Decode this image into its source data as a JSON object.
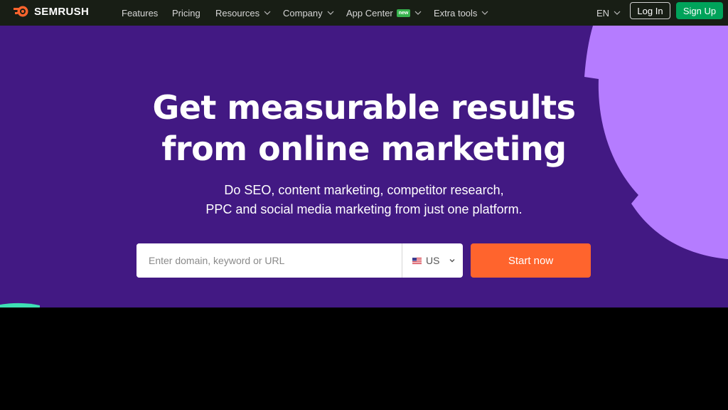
{
  "brand": {
    "name": "SEMRUSH",
    "logo_icon": "semrush-fire-icon",
    "accent": "#ff642d"
  },
  "nav": {
    "items": [
      {
        "label": "Features",
        "dropdown": false
      },
      {
        "label": "Pricing",
        "dropdown": false
      },
      {
        "label": "Resources",
        "dropdown": true
      },
      {
        "label": "Company",
        "dropdown": true
      },
      {
        "label": "App Center",
        "dropdown": true,
        "badge": "new"
      },
      {
        "label": "Extra tools",
        "dropdown": true
      }
    ],
    "language": "EN",
    "login_label": "Log In",
    "signup_label": "Sign Up"
  },
  "hero": {
    "title_line1": "Get measurable results",
    "title_line2": "from online marketing",
    "subtitle_line1": "Do SEO, content marketing, competitor research,",
    "subtitle_line2": "PPC and social media marketing from just one platform.",
    "search": {
      "placeholder": "Enter domain, keyword or URL",
      "value": ""
    },
    "country": "US",
    "start_label": "Start now"
  },
  "colors": {
    "nav_bg": "#181e15",
    "hero_bg": "#421983",
    "deco_purple": "#b57cff",
    "deco_teal": "#3ee0b4",
    "signup_green": "#00a35a",
    "start_orange": "#ff642d"
  }
}
